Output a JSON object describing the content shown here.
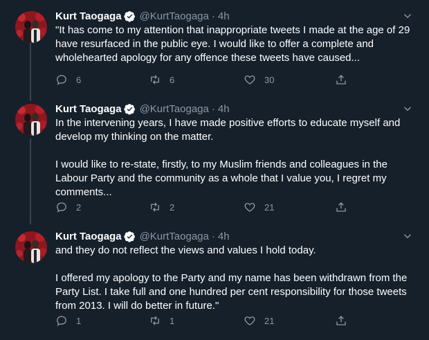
{
  "tweets": [
    {
      "name": "Kurt Taogaga",
      "handle": "@KurtTaogaga",
      "dot": "·",
      "time": "4h",
      "text": "\"It has come to my attention that inappropriate tweets I made at the age of 29 have resurfaced in the public eye. I would like to offer a complete and wholehearted apology for any offence these tweets have caused...",
      "replies": "6",
      "retweets": "6",
      "likes": "30"
    },
    {
      "name": "Kurt Taogaga",
      "handle": "@KurtTaogaga",
      "dot": "·",
      "time": "4h",
      "text": "In the intervening years, I have made positive efforts to educate myself and develop my thinking on the matter.\n\nI would like to re-state, firstly, to my Muslim friends and colleagues in the Labour Party and the community as a whole that I value you, I regret my comments...",
      "replies": "2",
      "retweets": "2",
      "likes": "21"
    },
    {
      "name": "Kurt Taogaga",
      "handle": "@KurtTaogaga",
      "dot": "·",
      "time": "4h",
      "text": "and they do not reflect the views and values I hold today.\n\nI offered my apology to the Party and my name has been withdrawn from the Party List. I take full and one hundred per cent responsibility for those tweets from 2013. I will do better in future.\"",
      "replies": "1",
      "retweets": "1",
      "likes": "21"
    }
  ],
  "colors": {
    "background": "#15202b",
    "text": "#ffffff",
    "secondary": "#8899a6",
    "verified": "#1da1f2",
    "thread_line": "#38444d"
  },
  "icons": [
    "avatar-photo",
    "verified-badge-icon",
    "caret-down-icon",
    "reply-icon",
    "retweet-icon",
    "like-icon",
    "share-icon"
  ]
}
